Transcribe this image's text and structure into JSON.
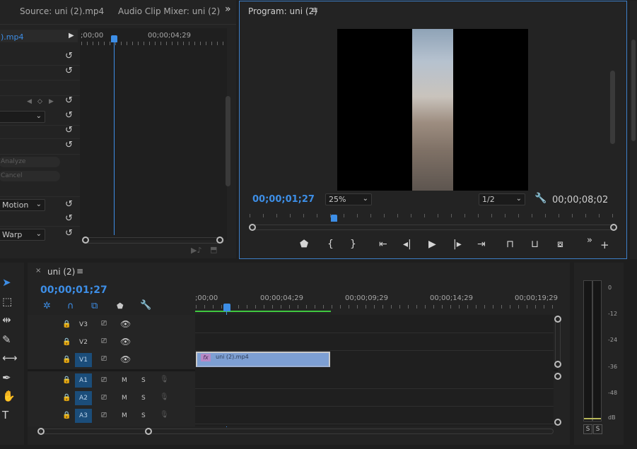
{
  "source_panel": {
    "tabs": [
      {
        "label": "Source: uni (2).mp4"
      },
      {
        "label": "Audio Clip Mixer: uni (2)"
      }
    ],
    "overflow_glyph": "»",
    "clip_label": ").mp4",
    "ruler_start": ";00;00",
    "ruler_mark": "00;00;04;29",
    "dropdown_motion": "Motion",
    "dropdown_warp": "Warp",
    "analyze_label": "Analyze",
    "cancel_label": "Cancel"
  },
  "program_monitor": {
    "title": "Program: uni (2)",
    "current_timecode": "00;00;01;27",
    "zoom_select": "25%",
    "resolution_select": "1/2",
    "duration_timecode": "00;00;08;02"
  },
  "timeline": {
    "sequence_name": "uni (2)",
    "timecode": "00;00;01;27",
    "ruler_labels": [
      ";00;00",
      "00;00;04;29",
      "00;00;09;29",
      "00;00;14;29",
      "00;00;19;29"
    ],
    "video_tracks": [
      "V3",
      "V2",
      "V1"
    ],
    "audio_tracks": [
      "A1",
      "A2",
      "A3"
    ],
    "clip": {
      "fx": "fx",
      "name": "uni (2).mp4"
    },
    "track_m": "M",
    "track_s": "S"
  },
  "audio_meter": {
    "scale": [
      "0",
      "-12",
      "-24",
      "-36",
      "-48",
      "dB"
    ],
    "solo_labels": [
      "S",
      "S"
    ]
  },
  "colors": {
    "accent_blue": "#3d8ee6",
    "clip_blue": "#7d9fd3",
    "track_target": "#1b4d7a",
    "work_area_green": "#3fc73f"
  }
}
